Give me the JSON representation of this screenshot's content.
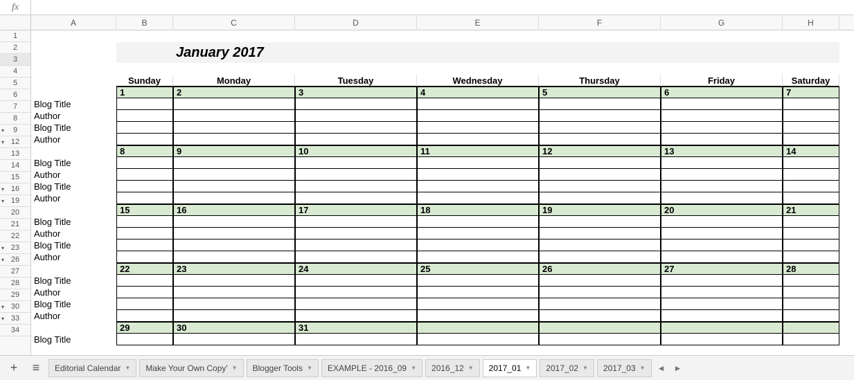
{
  "formula_bar": {
    "fx": "fx",
    "value": ""
  },
  "columns": [
    "A",
    "B",
    "C",
    "D",
    "E",
    "F",
    "G",
    "H"
  ],
  "rows": [
    {
      "n": "1"
    },
    {
      "n": "2"
    },
    {
      "n": "3",
      "selected": true
    },
    {
      "n": "4"
    },
    {
      "n": "5"
    },
    {
      "n": "6"
    },
    {
      "n": "7"
    },
    {
      "n": "8"
    },
    {
      "n": "9",
      "grp": true
    },
    {
      "n": "12",
      "grp": true
    },
    {
      "n": "13"
    },
    {
      "n": "14"
    },
    {
      "n": "15"
    },
    {
      "n": "16",
      "grp": true
    },
    {
      "n": "19",
      "grp": true
    },
    {
      "n": "20"
    },
    {
      "n": "21"
    },
    {
      "n": "22"
    },
    {
      "n": "23",
      "grp": true
    },
    {
      "n": "26",
      "grp": true
    },
    {
      "n": "27"
    },
    {
      "n": "28"
    },
    {
      "n": "29"
    },
    {
      "n": "30",
      "grp": true
    },
    {
      "n": "33",
      "grp": true
    },
    {
      "n": "34"
    }
  ],
  "title": "January 2017",
  "day_headers": [
    "Sunday",
    "Monday",
    "Tuesday",
    "Wednesday",
    "Thursday",
    "Friday",
    "Saturday"
  ],
  "label_rows": [
    "Blog Title",
    "Author",
    "Blog Title",
    "Author"
  ],
  "weeks": [
    {
      "nums": [
        "1",
        "2",
        "3",
        "4",
        "5",
        "6",
        "7"
      ],
      "labels": [
        "Blog Title",
        "Author",
        "Blog Title",
        "Author"
      ]
    },
    {
      "nums": [
        "8",
        "9",
        "10",
        "11",
        "12",
        "13",
        "14"
      ],
      "labels": [
        "Blog Title",
        "Author",
        "Blog Title",
        "Author"
      ]
    },
    {
      "nums": [
        "15",
        "16",
        "17",
        "18",
        "19",
        "20",
        "21"
      ],
      "labels": [
        "Blog Title",
        "Author",
        "Blog Title",
        "Author"
      ]
    },
    {
      "nums": [
        "22",
        "23",
        "24",
        "25",
        "26",
        "27",
        "28"
      ],
      "labels": [
        "Blog Title",
        "Author",
        "Blog Title",
        "Author"
      ]
    },
    {
      "nums": [
        "29",
        "30",
        "31",
        "",
        "",
        "",
        ""
      ],
      "labels": [
        "Blog Title"
      ]
    }
  ],
  "tabs": {
    "add": "+",
    "menu": "≡",
    "items": [
      {
        "label": "Editorial Calendar"
      },
      {
        "label": "Make Your Own Copy'"
      },
      {
        "label": "Blogger Tools"
      },
      {
        "label": "EXAMPLE - 2016_09"
      },
      {
        "label": "2016_12"
      },
      {
        "label": "2017_01",
        "active": true
      },
      {
        "label": "2017_02"
      },
      {
        "label": "2017_03"
      }
    ],
    "nav_left": "◄",
    "nav_right": "►"
  }
}
